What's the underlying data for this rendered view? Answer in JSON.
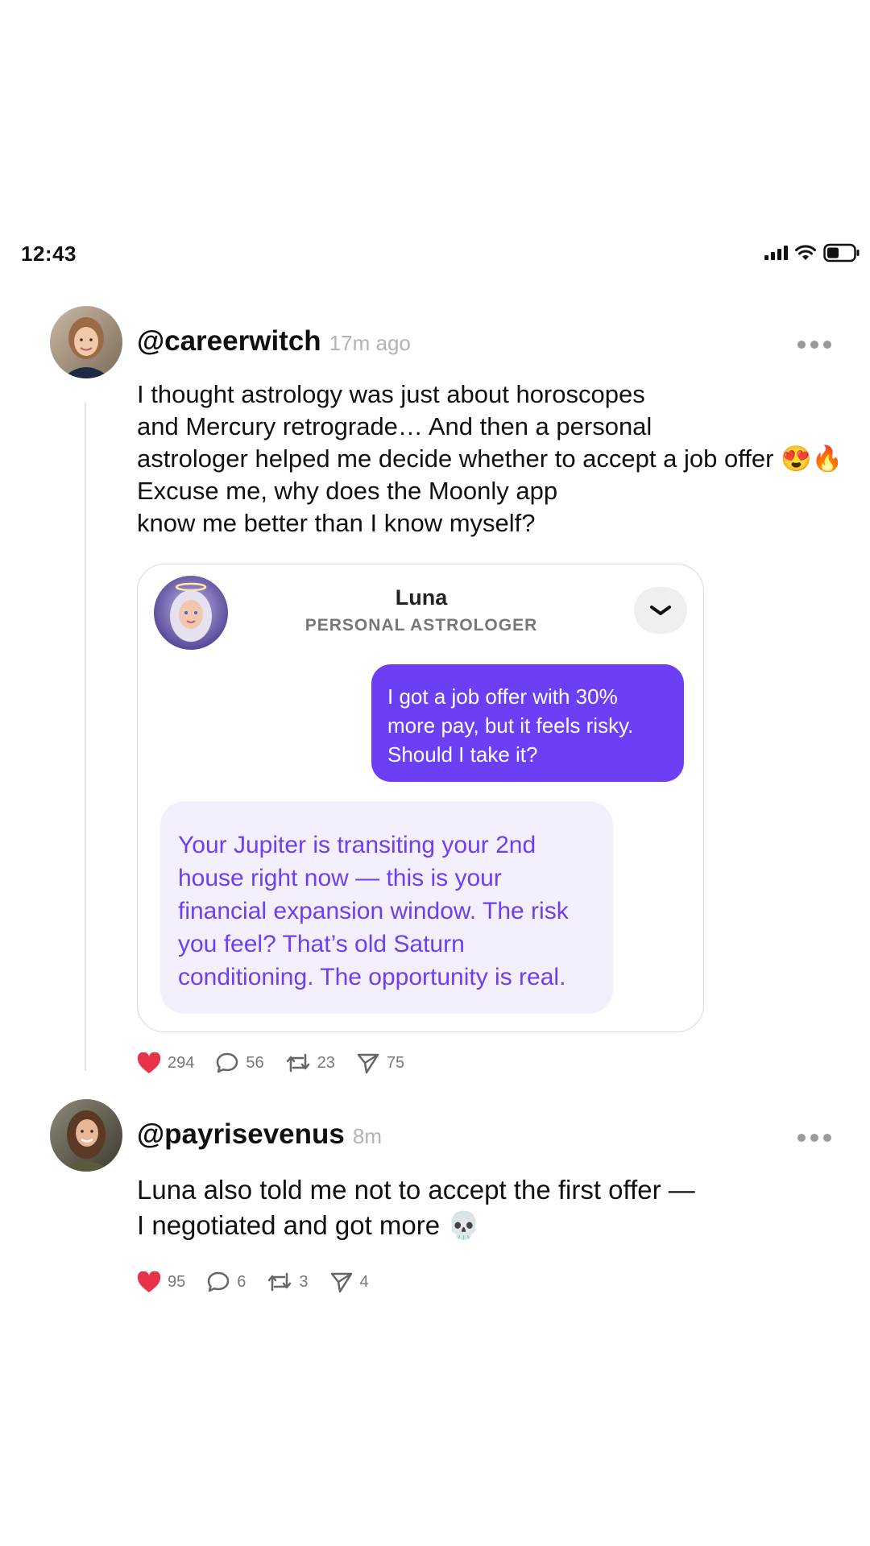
{
  "status_bar": {
    "time": "12:43",
    "icons": [
      "cellular-signal-icon",
      "wifi-icon",
      "battery-icon"
    ]
  },
  "post1": {
    "handle": "@careerwitch",
    "time_ago": "17m ago",
    "text": "I thought astrology was just about horoscopes\nand Mercury retrograde… And then a personal\nastrologer helped me decide whether to accept a job offer 😍🔥\nExcuse me, why does the Moonly app\nknow me better than I know myself?",
    "card": {
      "name": "Luna",
      "role": "PERSONAL ASTROLOGER",
      "user_message": "I got a job offer with 30%\nmore pay, but it feels risky.\nShould I take it?",
      "luna_reply": "Your Jupiter is transiting your 2nd\nhouse right now — this is your\nfinancial expansion window. The risk\nyou feel? That’s old Saturn\nconditioning. The opportunity is real."
    },
    "stats": {
      "likes": "294",
      "comments": "56",
      "reposts": "23",
      "shares": "75"
    }
  },
  "post2": {
    "handle": "@payrisevenus",
    "time_ago": "8m",
    "text": "Luna also told me not to accept the first offer —\nI negotiated and got more 💀",
    "stats": {
      "likes": "95",
      "comments": "6",
      "reposts": "3",
      "shares": "4"
    }
  },
  "colors": {
    "accent": "#6c3ff5",
    "luna_bubble": "#f3effd",
    "like": "#e8334a"
  }
}
